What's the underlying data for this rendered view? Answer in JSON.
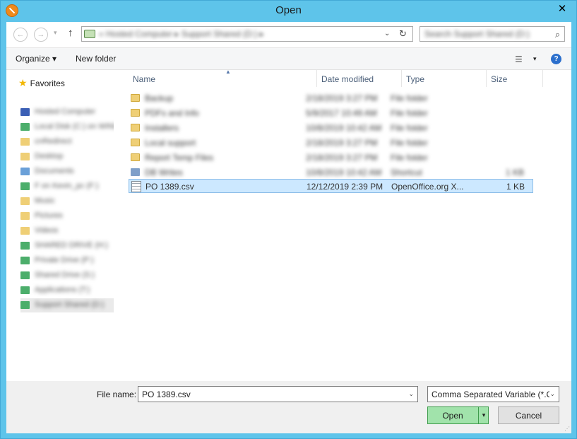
{
  "window": {
    "title": "Open",
    "close_label": "✕"
  },
  "address": {
    "path": "« Hosted Computer ▸ Support Shared (D:) ▸",
    "search_placeholder": "Search Support Shared (D:)"
  },
  "toolbar": {
    "organize": "Organize ▾",
    "new_folder": "New folder",
    "help": "?"
  },
  "navpane": {
    "favorites_label": "Favorites",
    "items": [
      {
        "label": "Hosted Computer",
        "color": "#3b5fb5"
      },
      {
        "label": "Local Disk (C:) on WINDOWS",
        "color": "#4cae6b"
      },
      {
        "label": "cnRedirect",
        "color": "#efcf76"
      },
      {
        "label": "Desktop",
        "color": "#efcf76"
      },
      {
        "label": "Documents",
        "color": "#6aa0d8"
      },
      {
        "label": "F on Kevin_pc (F:)",
        "color": "#4cae6b"
      },
      {
        "label": "Music",
        "color": "#efcf76"
      },
      {
        "label": "Pictures",
        "color": "#efcf76"
      },
      {
        "label": "Videos",
        "color": "#efcf76"
      },
      {
        "label": "SHARED DRIVE (H:)",
        "color": "#4cae6b"
      },
      {
        "label": "Private Drive (P:)",
        "color": "#4cae6b"
      },
      {
        "label": "Shared Drive (S:)",
        "color": "#4cae6b"
      },
      {
        "label": "Applications (T:)",
        "color": "#4cae6b"
      },
      {
        "label": "Support Shared (D:)",
        "color": "#4cae6b"
      }
    ]
  },
  "columns": {
    "name": "Name",
    "date": "Date modified",
    "type": "Type",
    "size": "Size"
  },
  "files": [
    {
      "name": "Backup",
      "date": "2/18/2019 3:27 PM",
      "type": "File folder",
      "size": "",
      "kind": "folder",
      "blurred": true
    },
    {
      "name": "PDFs and Info",
      "date": "5/9/2017 10:49 AM",
      "type": "File folder",
      "size": "",
      "kind": "folder",
      "blurred": true
    },
    {
      "name": "Installers",
      "date": "10/8/2019 10:42 AM",
      "type": "File folder",
      "size": "",
      "kind": "folder",
      "blurred": true
    },
    {
      "name": "Local support",
      "date": "2/18/2019 3:27 PM",
      "type": "File folder",
      "size": "",
      "kind": "folder",
      "blurred": true
    },
    {
      "name": "Report Temp Files",
      "date": "2/18/2019 3:27 PM",
      "type": "File folder",
      "size": "",
      "kind": "folder",
      "blurred": true
    },
    {
      "name": "DB Writes",
      "date": "10/8/2019 10:42 AM",
      "type": "Shortcut",
      "size": "1 KB",
      "kind": "other",
      "blurred": true
    },
    {
      "name": "PO 1389.csv",
      "date": "12/12/2019 2:39 PM",
      "type": "OpenOffice.org X...",
      "size": "1 KB",
      "kind": "csv",
      "blurred": false
    }
  ],
  "footer": {
    "file_name_label": "File name:",
    "file_name_value": "PO 1389.csv",
    "file_type_value": "Comma Separated Variable (*.C",
    "open_label": "Open",
    "cancel_label": "Cancel"
  }
}
